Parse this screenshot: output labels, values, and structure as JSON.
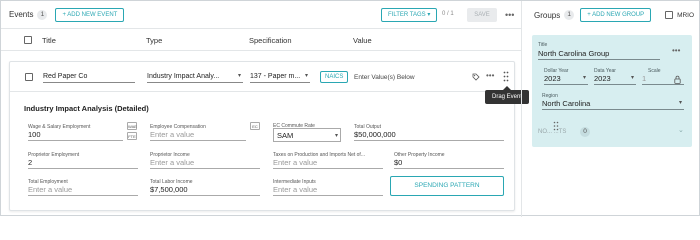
{
  "events": {
    "title": "Events",
    "count": "1",
    "add_button": "+ ADD NEW EVENT",
    "filter_button": "FILTER TAGS",
    "filter_caret": "▾",
    "selection_count": "0 / 1",
    "save_button": "SAVE",
    "more": "•••"
  },
  "table_header": {
    "title": "Title",
    "type": "Type",
    "specification": "Specification",
    "value": "Value"
  },
  "event_row": {
    "title": "Red Paper Co",
    "type": "Industry Impact Analy...",
    "specification": "137 - Paper m...",
    "naics_button": "NAICS",
    "value_placeholder": "Enter Value(s) Below",
    "drag_tooltip": "Drag Event"
  },
  "details": {
    "section_title": "Industry Impact Analysis (Detailed)",
    "fields": {
      "wage_label": "Wage & Salary Employment",
      "wage_value": "100",
      "wage_badge1": "WAE",
      "wage_badge2": "FTE",
      "emp_comp_label": "Employee Compensation",
      "emp_comp_placeholder": "Enter a value",
      "emp_comp_badge": "EC",
      "commute_label": "EC Commute Rate",
      "commute_value": "SAM",
      "total_output_label": "Total Output",
      "total_output_value": "$50,000,000",
      "prop_emp_label": "Proprietor Employment",
      "prop_emp_value": "2",
      "prop_income_label": "Proprietor Income",
      "prop_income_placeholder": "Enter a value",
      "taxes_label": "Taxes on Production and Imports Net of...",
      "taxes_placeholder": "Enter a value",
      "opi_label": "Other Property Income",
      "opi_value": "$0",
      "total_emp_label": "Total Employment",
      "total_emp_placeholder": "Enter a value",
      "total_labor_label": "Total Labor Income",
      "total_labor_value": "$7,500,000",
      "intermediate_label": "Intermediate Inputs",
      "intermediate_placeholder": "Enter a value"
    },
    "spending_button": "SPENDING PATTERN"
  },
  "groups": {
    "title": "Groups",
    "count": "1",
    "add_button": "+ ADD NEW GROUP",
    "mrio_label": "MRIO",
    "group": {
      "title_label": "Title",
      "title_value": "North Carolina Group",
      "dollar_year_label": "Dollar Year",
      "dollar_year_value": "2023",
      "data_year_label": "Data Year",
      "data_year_value": "2023",
      "scale_label": "Scale",
      "scale_value": "1",
      "region_label": "Region",
      "region_value": "North Carolina",
      "events_label": "NO... ...TS",
      "events_count": "0"
    }
  },
  "colors": {
    "accent": "#2aa7b3",
    "panel": "#d7eef0"
  }
}
